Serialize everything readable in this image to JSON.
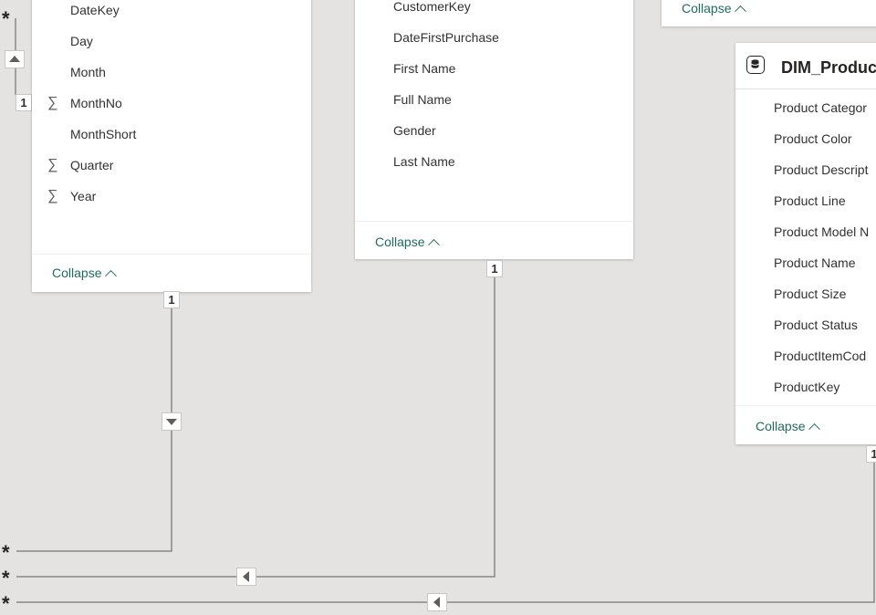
{
  "date_table": {
    "fields": [
      {
        "label": "DateKey",
        "sigma": false
      },
      {
        "label": "Day",
        "sigma": false
      },
      {
        "label": "Month",
        "sigma": false
      },
      {
        "label": "MonthNo",
        "sigma": true
      },
      {
        "label": "MonthShort",
        "sigma": false
      },
      {
        "label": "Quarter",
        "sigma": true
      },
      {
        "label": "Year",
        "sigma": true
      }
    ],
    "collapse_label": "Collapse"
  },
  "customer_table": {
    "fields": [
      {
        "label": "CustomerKey"
      },
      {
        "label": "DateFirstPurchase"
      },
      {
        "label": "First Name"
      },
      {
        "label": "Full Name"
      },
      {
        "label": "Gender"
      },
      {
        "label": "Last Name"
      }
    ],
    "collapse_label": "Collapse"
  },
  "top_right_card": {
    "collapse_label": "Collapse"
  },
  "product_table": {
    "title": "DIM_Product",
    "fields": [
      {
        "label": "Product Categor"
      },
      {
        "label": "Product Color"
      },
      {
        "label": "Product Descript"
      },
      {
        "label": "Product Line"
      },
      {
        "label": "Product Model N"
      },
      {
        "label": "Product Name"
      },
      {
        "label": "Product Size"
      },
      {
        "label": "Product Status"
      },
      {
        "label": "ProductItemCod"
      },
      {
        "label": "ProductKey"
      }
    ],
    "collapse_label": "Collapse"
  },
  "relationships": {
    "one_symbol": "1",
    "many_symbol": "*"
  }
}
